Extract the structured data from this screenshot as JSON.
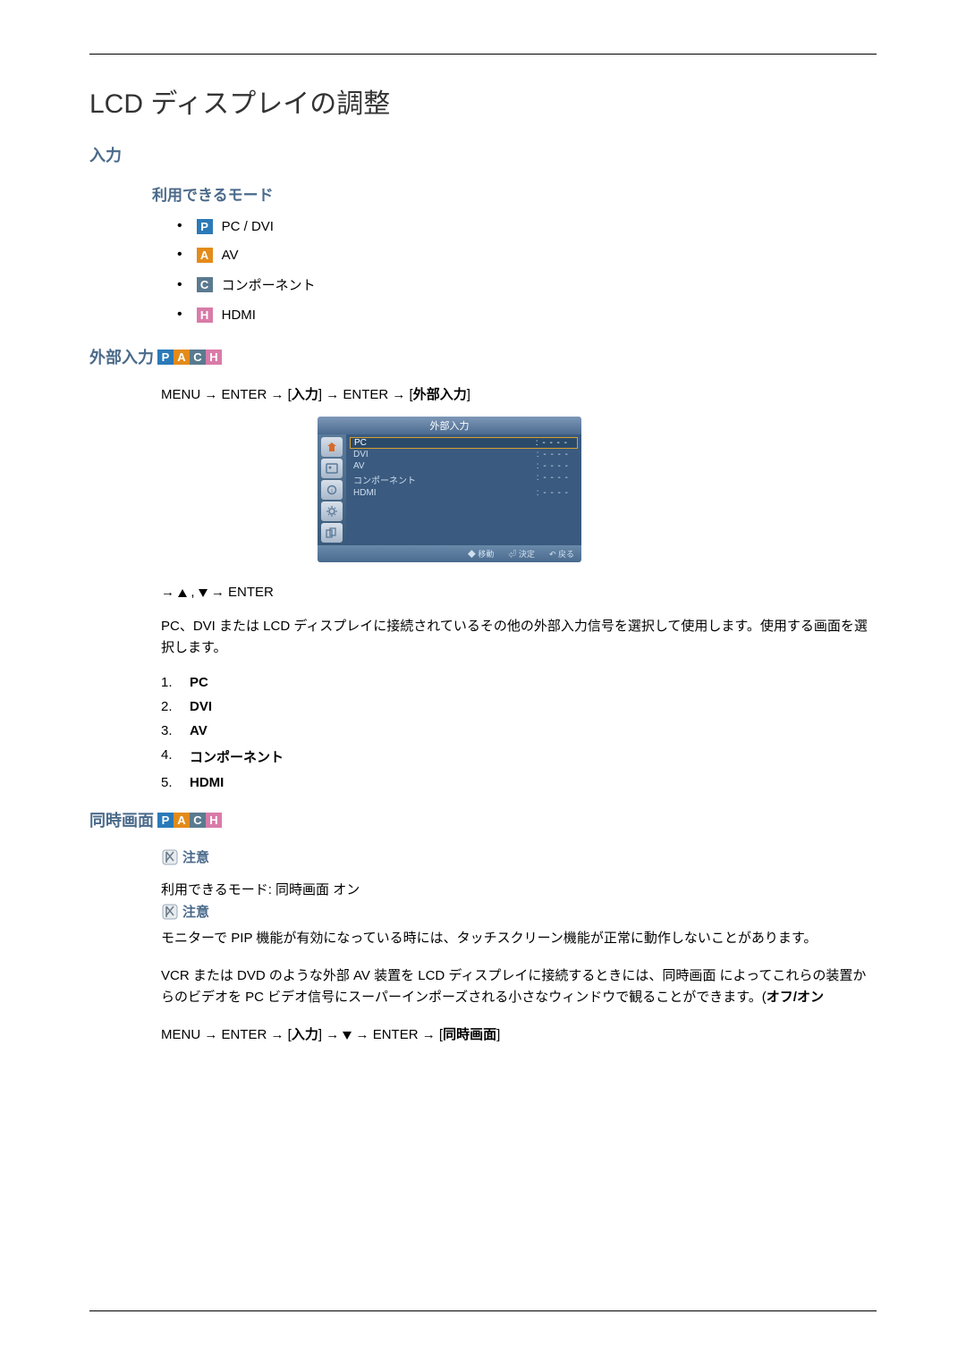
{
  "title": "LCD ディスプレイの調整",
  "sections": {
    "input": {
      "heading": "入力",
      "modes_heading": "利用できるモード",
      "modes": [
        {
          "badge": "P",
          "cls": "badge-p",
          "label": "PC / DVI"
        },
        {
          "badge": "A",
          "cls": "badge-a",
          "label": "AV"
        },
        {
          "badge": "C",
          "cls": "badge-c",
          "label": "コンポーネント"
        },
        {
          "badge": "H",
          "cls": "badge-h",
          "label": "HDMI"
        }
      ]
    },
    "external": {
      "heading": "外部入力",
      "path1": "MENU → ENTER → [",
      "path1b": "入力",
      "path2": "] → ENTER → [",
      "path2b": "外部入力",
      "path3": "]",
      "osd": {
        "title": "外部入力",
        "rows": [
          {
            "label": "PC",
            "val": ": - - - -",
            "sel": true
          },
          {
            "label": "DVI",
            "val": ": - - - -"
          },
          {
            "label": "AV",
            "val": ": - - - -"
          },
          {
            "label": "コンポーネント",
            "val": ": - - - -"
          },
          {
            "label": "HDMI",
            "val": ": - - - -"
          }
        ],
        "footer": [
          "移動",
          "決定",
          "戻る"
        ]
      },
      "arrowline_pre": "→ ",
      "arrowline_mid": " , ",
      "arrowline_post": " → ENTER",
      "para": "PC、DVI または LCD ディスプレイに接続されているその他の外部入力信号を選択して使用します。使用する画面を選択します。",
      "list": [
        "PC",
        "DVI",
        "AV",
        "コンポーネント",
        "HDMI"
      ]
    },
    "pip": {
      "heading": "同時画面",
      "note_label": "注意",
      "mode_line": "利用できるモード: 同時画面 オン",
      "para1": "モニターで PIP 機能が有効になっている時には、タッチスクリーン機能が正常に動作しないことがあります。",
      "para2_a": "VCR または DVD のような外部 AV 装置を LCD ディスプレイに接続するときには、同時画面 によってこれらの装置からのビデオを PC ビデオ信号にスーパーインポーズされる小さなウィンドウで観ることができます。(",
      "para2_b": "オフ/オン",
      "path_a": "MENU → ENTER → [",
      "path_b": "入力",
      "path_c": "] → ",
      "path_d": " → ENTER → [",
      "path_e": "同時画面",
      "path_f": "]"
    }
  }
}
